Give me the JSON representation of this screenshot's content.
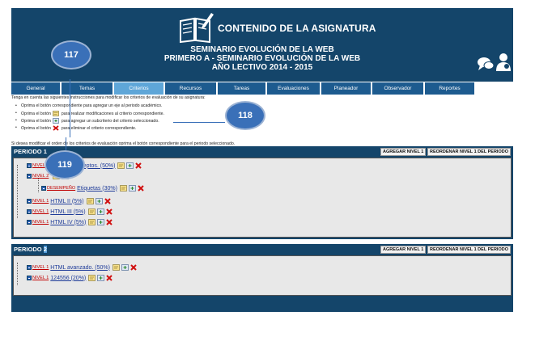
{
  "header": {
    "title": "CONTENIDO DE LA ASIGNATURA",
    "line1": "SEMINARIO EVOLUCIÓN DE LA WEB",
    "line2": "PRIMERO A - SEMINARIO EVOLUCIÓN DE LA WEB",
    "line3": "AÑO LECTIVO 2014 - 2015"
  },
  "nav": {
    "tabs": [
      {
        "label": "General"
      },
      {
        "label": "Temas"
      },
      {
        "label": "Criterios",
        "active": true
      },
      {
        "label": "Recursos"
      },
      {
        "label": "Tareas"
      },
      {
        "label": "Evaluaciones"
      },
      {
        "label": "Planeador"
      },
      {
        "label": "Observador"
      },
      {
        "label": "Reportes"
      }
    ]
  },
  "instructions": {
    "intro": "Tenga en cuenta las siguientes instrucciones para modificar los criterios de evaluación de su asignatura:",
    "bullets": [
      {
        "pre": "Oprima el botón",
        "post": "correspondiente para agregar un eje al periodo académico."
      },
      {
        "pre": "Oprima el botón",
        "post": "para realizar modificaciones al criterio correspondiente."
      },
      {
        "pre": "Oprima el botón",
        "post": "para agregar un subcriterio del criterio seleccionado."
      },
      {
        "pre": "Oprima el botón",
        "post": "para eliminar el criterio correspondiente."
      }
    ],
    "footer": "Si desea modificar el orden de los criterios de evaluación oprima el botón correspondiente para el periodo seleccionado."
  },
  "periods": [
    {
      "title_prefix": "PERIODO",
      "title_number": "1",
      "add_button": "AGREGAR NIVEL 1",
      "reorder_button": "REORDENAR NIVEL 1 DEL PERIODO",
      "criteria": [
        {
          "level": "NIVEL 1",
          "text": "Nuevos conceptos. (50%)"
        },
        {
          "level": "NIVEL 2",
          "text": ""
        },
        {
          "level": "DESEMPEÑO",
          "text": "Etiquetas (30%)"
        },
        {
          "level": "NIVEL 1",
          "text": "HTML II (5%)"
        },
        {
          "level": "NIVEL 1",
          "text": "HTML III (5%)"
        },
        {
          "level": "NIVEL 1",
          "text": "HTML IV (5%)"
        }
      ]
    },
    {
      "title_prefix": "PERIODO",
      "title_number": "2",
      "add_button": "AGREGAR NIVEL 1",
      "reorder_button": "REORDENAR NIVEL 1 DEL PERIODO",
      "criteria": [
        {
          "level": "NIVEL 1",
          "text": "HTML avanzado. (50%)"
        },
        {
          "level": "NIVEL 1",
          "text": "124556 (20%)"
        }
      ]
    }
  ],
  "callouts": {
    "c117": "117",
    "c118": "118",
    "c119": "119"
  },
  "colors": {
    "header_bg": "#14456a",
    "tab_bg": "#1d5b8f",
    "tab_active": "#5ea6d8",
    "callout": "#3a70b8",
    "level_red": "#c00000"
  }
}
